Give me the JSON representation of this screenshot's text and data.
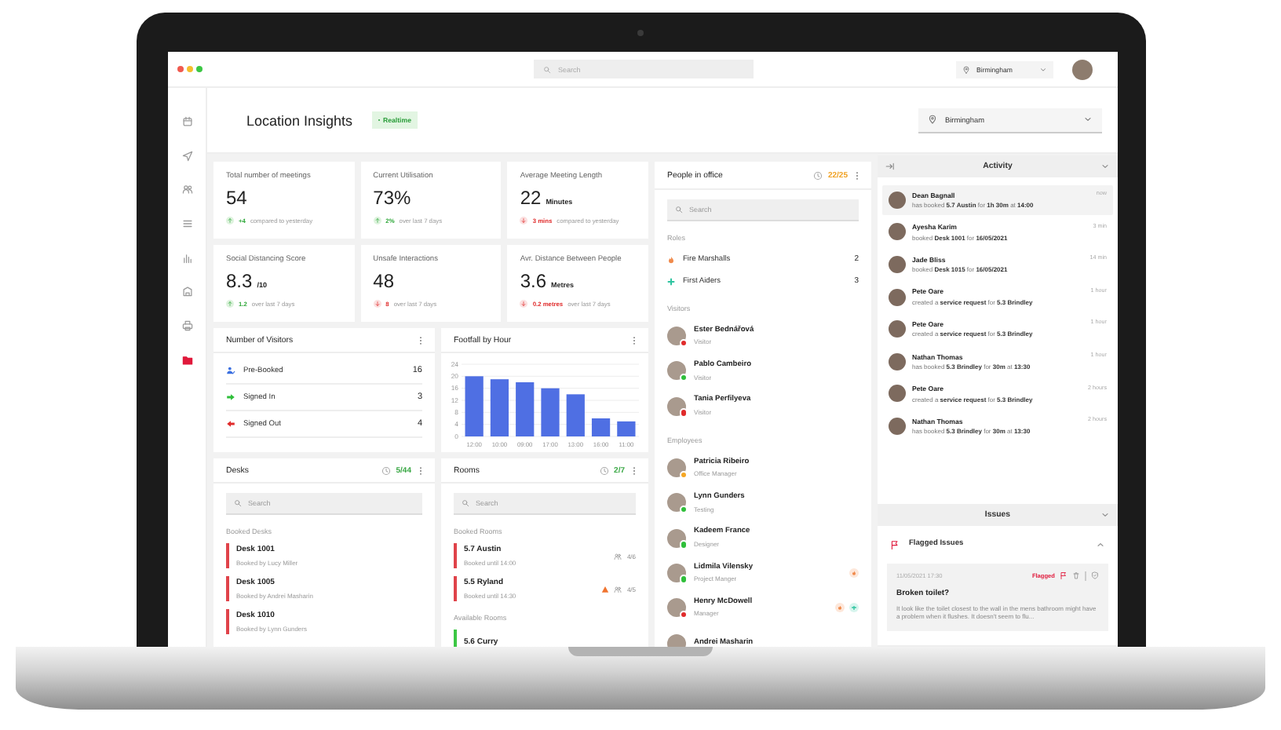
{
  "topbar": {
    "search_placeholder": "Search",
    "location": "Birmingham"
  },
  "sidebar": {
    "items": [
      {
        "kind": "calendar",
        "selected": false
      },
      {
        "kind": "send",
        "selected": false
      },
      {
        "kind": "people",
        "selected": false
      },
      {
        "kind": "list",
        "selected": false
      },
      {
        "kind": "bars",
        "selected": false
      },
      {
        "kind": "building",
        "selected": false
      },
      {
        "kind": "printer",
        "selected": false
      },
      {
        "kind": "folder",
        "selected": true
      }
    ]
  },
  "header": {
    "title": "Location Insights",
    "badge": "Realtime",
    "location": "Birmingham"
  },
  "stats": [
    {
      "label": "Total number of meetings",
      "value": "54",
      "increase": true,
      "change": "+4",
      "note": "compared to yesterday"
    },
    {
      "label": "Current Utilisation",
      "value": "73%",
      "increase": true,
      "change": "2%",
      "note": "over last 7 days"
    },
    {
      "label": "Average Meeting Length",
      "value": "22",
      "unit": "Minutes",
      "increase": false,
      "change": "3 mins",
      "note": "compared to yesterday"
    },
    {
      "label": "Social Distancing Score",
      "value": "8.3",
      "unit": "/10",
      "increase": true,
      "change": "1.2",
      "note": "over last 7 days"
    },
    {
      "label": "Unsafe Interactions",
      "value": "48",
      "increase": false,
      "change": "8",
      "note": "over last 7 days"
    },
    {
      "label": "Avr. Distance Between People",
      "value": "3.6",
      "unit": "Metres",
      "increase": false,
      "change": "0.2 metres",
      "note": "over last 7 days"
    }
  ],
  "visitors": {
    "title": "Number of Visitors",
    "rows": [
      {
        "kind": "prebooked",
        "label": "Pre-Booked",
        "count": "16"
      },
      {
        "kind": "in",
        "label": "Signed In",
        "count": "3"
      },
      {
        "kind": "out",
        "label": "Signed Out",
        "count": "4"
      }
    ]
  },
  "footfall": {
    "chart_data": {
      "type": "bar",
      "title": "Footfall by Hour",
      "categories": [
        "12:00",
        "10:00",
        "09:00",
        "17:00",
        "13:00",
        "16:00",
        "11:00"
      ],
      "yticks": [
        0,
        4,
        8,
        12,
        16,
        20,
        24
      ],
      "ylim": [
        0,
        24
      ],
      "grid": true,
      "series": [
        {
          "color": "#4f6fe3",
          "values": [
            20,
            19,
            18,
            16,
            14,
            6,
            5
          ]
        }
      ]
    }
  },
  "desks": {
    "title": "Desks",
    "count": "5/44",
    "search_placeholder": "Search",
    "sections": [
      {
        "label": "Booked Desks",
        "items": [
          {
            "name": "Desk 1001",
            "detail": "Booked by Lucy Miller",
            "available": false
          },
          {
            "name": "Desk 1005",
            "detail": "Booked by Andrei Masharin",
            "available": false
          },
          {
            "name": "Desk 1010",
            "detail": "Booked by Lynn Gunders",
            "available": false
          }
        ]
      }
    ]
  },
  "rooms": {
    "title": "Rooms",
    "count": "2/7",
    "search_placeholder": "Search",
    "sections": [
      {
        "label": "Booked Rooms",
        "items": [
          {
            "name": "5.7 Austin",
            "detail": "Booked until 14:00",
            "available": false,
            "capacity": "4/6",
            "warning": false
          },
          {
            "name": "5.5 Ryland",
            "detail": "Booked until 14:30",
            "available": false,
            "capacity": "4/5",
            "warning": true
          }
        ]
      },
      {
        "label": "Available Rooms",
        "items": [
          {
            "name": "5.6 Curry",
            "available": true
          }
        ]
      }
    ]
  },
  "people": {
    "title": "People in office",
    "count": "22/25",
    "search_placeholder": "Search",
    "roles_label": "Roles",
    "roles": [
      {
        "kind": "fire",
        "label": "Fire Marshalls",
        "count": "2"
      },
      {
        "kind": "aid",
        "label": "First Aiders",
        "count": "3"
      }
    ],
    "visitors_label": "Visitors",
    "visitors": [
      {
        "name": "Ester Bednářová",
        "role": "Visitor",
        "color": "#e02b2b"
      },
      {
        "name": "Pablo Cambeiro",
        "role": "Visitor",
        "color": "#2fbf3a"
      },
      {
        "name": "Tania Perfilyeva",
        "role": "Visitor",
        "color": "#e02b2b"
      }
    ],
    "employees_label": "Employees",
    "employees": [
      {
        "name": "Patricia Ribeiro",
        "role": "Office Manager",
        "color": "#f5a623",
        "fire_marshal": false,
        "first_aider": false
      },
      {
        "name": "Lynn Gunders",
        "role": "Testing",
        "color": "#2fbf3a",
        "fire_marshal": false,
        "first_aider": false
      },
      {
        "name": "Kadeem France",
        "role": "Designer",
        "color": "#2fbf3a",
        "fire_marshal": false,
        "first_aider": false
      },
      {
        "name": "Lidmila Vilensky",
        "role": "Project Manger",
        "color": "#2fbf3a",
        "fire_marshal": true,
        "first_aider": false
      },
      {
        "name": "Henry McDowell",
        "role": "Manager",
        "color": "#e02b2b",
        "fire_marshal": true,
        "first_aider": true
      },
      {
        "name": "Andrei Masharin",
        "fire_marshal": false,
        "first_aider": false
      }
    ]
  },
  "activity": {
    "title": "Activity",
    "items": [
      {
        "name": "Dean Bagnall",
        "text": "has booked **5.7 Austin** for **1h 30m** at **14:00**",
        "time": "now",
        "selected": true
      },
      {
        "name": "Ayesha Karim",
        "text": "booked **Desk 1001** for **16/05/2021**",
        "time": "3 min",
        "selected": false
      },
      {
        "name": "Jade Bliss",
        "text": "booked **Desk 1015** for **16/05/2021**",
        "time": "14 min",
        "selected": false
      },
      {
        "name": "Pete Oare",
        "text": "created a **service request** for **5.3 Brindley**",
        "time": "1 hour",
        "selected": false
      },
      {
        "name": "Pete Oare",
        "text": "created a **service request** for **5.3 Brindley**",
        "time": "1 hour",
        "selected": false
      },
      {
        "name": "Nathan Thomas",
        "text": "has booked **5.3 Brindley** for **30m** at **13:30**",
        "time": "1 hour",
        "selected": false
      },
      {
        "name": "Pete Oare",
        "text": "created a **service request** for **5.3 Brindley**",
        "time": "2 hours",
        "selected": false
      },
      {
        "name": "Nathan Thomas",
        "text": "has booked **5.3 Brindley** for **30m** at **13:30**",
        "time": "2 hours",
        "selected": false
      }
    ]
  },
  "issues": {
    "title": "Issues",
    "group": "Flagged Issues",
    "items": [
      {
        "date": "11/05/2021 17:30",
        "status": "Flagged",
        "title": "Broken toilet?",
        "text": "It look like the toilet closest to the wall in the mens bathroom might have a problem when it flushes. It doesn't seem to flu..."
      }
    ]
  }
}
